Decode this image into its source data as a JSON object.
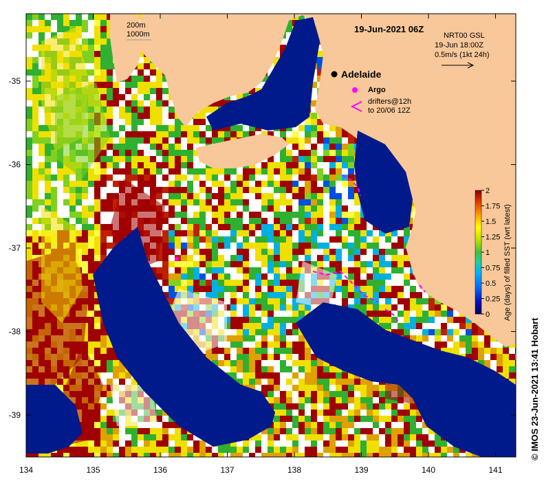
{
  "map": {
    "title": "19-Jun-2021 06Z",
    "product": "NRT00 GSL",
    "time": "19-Jun 18:00Z",
    "arrow_scale": "0.5m/s (1kt 24h)",
    "contours": {
      "c1": "200m",
      "c2": "1000m"
    },
    "city": "Adelaide",
    "argo_label": "Argo",
    "drifters_line1": "drifters@12h",
    "drifters_line2": "to 20/06 12Z",
    "credit": "© IMOS 23-Jun-2021 13:41 Hobart",
    "x_ticks": [
      "134",
      "135",
      "136",
      "137",
      "138",
      "139",
      "140",
      "141"
    ],
    "y_ticks": [
      "-35",
      "-36",
      "-37",
      "-38",
      "-39"
    ],
    "colorbar": {
      "label": "Age (days) of filled SST (wrt latest)",
      "ticks": [
        "2",
        "1.75",
        "1.5",
        "1.25",
        "1",
        "0.75",
        "0.5",
        "0.25",
        "0"
      ]
    },
    "colors": {
      "land": "#f8c89a",
      "deep": "#001a8c",
      "white": "#ffffff",
      "darkred": "#a00000",
      "yellow": "#f0e000",
      "green": "#30b030",
      "argo": "#ff00ff"
    }
  }
}
